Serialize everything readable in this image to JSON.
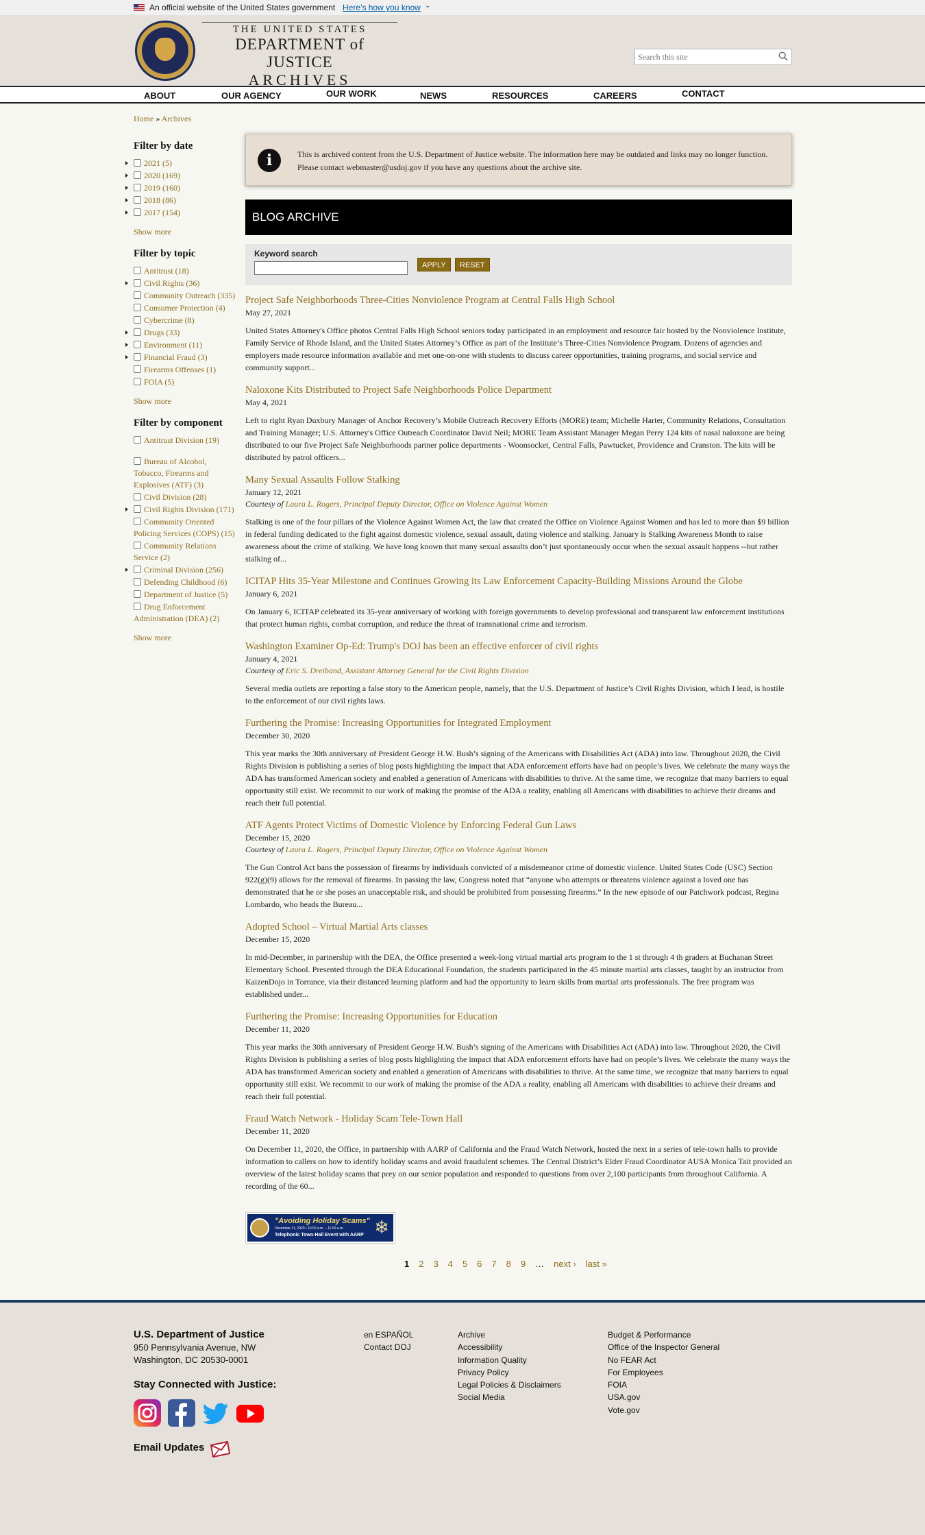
{
  "gov_banner": {
    "official_text": "An official website of the United States government",
    "how_link": "Here’s how you know"
  },
  "header": {
    "logo_line1": "THE UNITED STATES",
    "logo_line2": "DEPARTMENT of JUSTICE",
    "logo_line3": "ARCHIVES",
    "search_placeholder": "Search this site"
  },
  "nav": [
    "ABOUT",
    "OUR AGENCY",
    "OUR WORK",
    "NEWS",
    "RESOURCES",
    "CAREERS",
    "CONTACT"
  ],
  "breadcrumb": {
    "home": "Home",
    "sep": "»",
    "current": "Archives"
  },
  "sidebar": {
    "date_heading": "Filter by date",
    "dates": [
      {
        "label": "2021 (5)",
        "expandable": true
      },
      {
        "label": "2020 (169)",
        "expandable": true
      },
      {
        "label": "2019 (160)",
        "expandable": true
      },
      {
        "label": "2018 (86)",
        "expandable": true
      },
      {
        "label": "2017 (154)",
        "expandable": true
      }
    ],
    "topic_heading": "Filter by topic",
    "topics": [
      {
        "label": "Antitrust (18)",
        "expandable": false
      },
      {
        "label": "Civil Rights (36)",
        "expandable": true
      },
      {
        "label": "Community Outreach (335)",
        "expandable": false
      },
      {
        "label": "Consumer Protection (4)",
        "expandable": false
      },
      {
        "label": "Cybercrime (8)",
        "expandable": false
      },
      {
        "label": "Drugs (33)",
        "expandable": true
      },
      {
        "label": "Environment (11)",
        "expandable": true
      },
      {
        "label": "Financial Fraud (3)",
        "expandable": true
      },
      {
        "label": "Firearms Offenses (1)",
        "expandable": false
      },
      {
        "label": "FOIA (5)",
        "expandable": false
      }
    ],
    "component_heading": "Filter by component",
    "components": [
      {
        "label": "Antitrust Division (19)",
        "expandable": false
      },
      {
        "label": "Bureau of Alcohol, Tobacco, Firearms and Explosives (ATF) (3)",
        "expandable": false
      },
      {
        "label": "Civil Division (28)",
        "expandable": false
      },
      {
        "label": "Civil Rights Division (171)",
        "expandable": true
      },
      {
        "label": "Community Oriented Policing Services (COPS) (15)",
        "expandable": false
      },
      {
        "label": "Community Relations Service (2)",
        "expandable": false
      },
      {
        "label": "Criminal Division (256)",
        "expandable": true
      },
      {
        "label": "Defending Childhood (6)",
        "expandable": false
      },
      {
        "label": "Department of Justice (5)",
        "expandable": false
      },
      {
        "label": "Drug Enforcement Administration (DEA) (2)",
        "expandable": false
      }
    ],
    "show_more": "Show more"
  },
  "notice": {
    "text": "This is archived content from the U.S. Department of Justice website. The information here may be outdated and links may no longer function. Please contact webmaster@usdoj.gov if you have any questions about the archive site."
  },
  "blog": {
    "title": "BLOG ARCHIVE",
    "keyword_label": "Keyword search",
    "apply": "APPLY",
    "reset": "RESET"
  },
  "posts": [
    {
      "title": "Project Safe Neighborhoods Three-Cities Nonviolence Program at Central Falls High School",
      "date": "May 27, 2021",
      "body": "United States Attorney's Office photos Central Falls High School seniors today participated in an employment and resource fair hosted by the Nonviolence Institute, Family Service of Rhode Island, and the United States Attorney’s Office as part of the Institute’s Three-Cities Nonviolence Program. Dozens of agencies and employers made resource information available and met one-on-one with students to discuss career opportunities, training programs, and social service and community support..."
    },
    {
      "title": "Naloxone Kits Distributed to Project Safe Neighborhoods Police Department",
      "date": "May 4, 2021",
      "body": "Left to right Ryan Duxbury Manager of Anchor Recovery’s Mobile Outreach Recovery Efforts (MORE) team; Michelle Harter, Community Relations, Consultation and Training Manager; U.S. Attorney's Office Outreach Coordinator David Neil; MORE Team Assistant Manager Megan Perry 124 kits of nasal naloxone are being distributed to our five Project Safe Neighborhoods partner police departments - Woonsocket, Central Falls, Pawtucket, Providence and Cranston. The kits will be distributed by patrol officers..."
    },
    {
      "title": "Many Sexual Assaults Follow Stalking",
      "date": "January 12, 2021",
      "by_prefix": "Courtesy of",
      "author": "Laura L. Rogers, Principal Deputy Director, Office on Violence Against Women",
      "body": "Stalking is one of the four pillars of the Violence Against Women Act, the law that created the Office on Violence Against Women and has led to more than $9 billion in federal funding dedicated to the fight against domestic violence, sexual assault, dating violence and stalking. January is Stalking Awareness Month to raise awareness about the crime of stalking. We have long known that many sexual assaults don’t just spontaneously occur when the sexual assault happens --but rather stalking of..."
    },
    {
      "title": "ICITAP Hits 35-Year Milestone and Continues Growing its Law Enforcement Capacity-Building Missions Around the Globe",
      "date": "January 6, 2021",
      "body": "On January 6, ICITAP celebrated its 35-year anniversary of working with foreign governments to develop professional and transparent law enforcement institutions that protect human rights, combat corruption, and reduce the threat of transnational crime and terrorism."
    },
    {
      "title": "Washington Examiner Op-Ed: Trump's DOJ has been an effective enforcer of civil rights",
      "date": "January 4, 2021",
      "by_prefix": "Courtesy of",
      "author": "Eric S. Dreiband, Assistant Attorney General for the Civil Rights Division",
      "body": "Several media outlets are reporting a false story to the American people, namely, that the U.S. Department of Justice’s Civil Rights Division, which I lead, is hostile to the enforcement of our civil rights laws."
    },
    {
      "title": "Furthering the Promise: Increasing Opportunities for Integrated Employment",
      "date": "December 30, 2020",
      "body": "This year marks the 30th anniversary of President George H.W. Bush’s signing of the Americans with Disabilities Act (ADA) into law. Throughout 2020, the Civil Rights Division is publishing a series of blog posts highlighting the impact that ADA enforcement efforts have had on people’s lives. We celebrate the many ways the ADA has transformed American society and enabled a generation of Americans with disabilities to thrive. At the same time, we recognize that many barriers to equal opportunity still exist. We recommit to our work of making the promise of the ADA a reality, enabling all Americans with disabilities to achieve their dreams and reach their full potential."
    },
    {
      "title": "ATF Agents Protect Victims of Domestic Violence by Enforcing Federal Gun Laws",
      "date": "December 15, 2020",
      "by_prefix": "Courtesy of",
      "author": "Laura L. Rogers, Principal Deputy Director, Office on Violence Against Women",
      "body": "The Gun Control Act bans the possession of firearms by individuals convicted of a misdemeanor crime of domestic violence. United States Code (USC) Section 922(g)(9) allows for the removal of firearms. In passing the law, Congress noted that “anyone who attempts or threatens violence against a loved one has demonstrated that he or she poses an unacceptable risk, and should be prohibited from possessing firearms.” In the new episode of our Patchwork podcast, Regina Lombardo, who heads the Bureau..."
    },
    {
      "title": "Adopted School – Virtual Martial Arts classes",
      "date": "December 15, 2020",
      "body": "In mid-December, in partnership with the DEA, the Office presented a week-long virtual martial arts program to the 1 st through 4 th graders at Buchanan Street Elementary School. Presented through the DEA Educational Foundation, the students participated in the 45 minute martial arts classes, taught by an instructor from KaizenDojo in Torrance, via their distanced learning platform and had the opportunity to learn skills from martial arts professionals. The free program was established under..."
    },
    {
      "title": "Furthering the Promise: Increasing Opportunities for Education",
      "date": "December 11, 2020",
      "body": "This year marks the 30th anniversary of President George H.W. Bush’s signing of the Americans with Disabilities Act (ADA) into law. Throughout 2020, the Civil Rights Division is publishing a series of blog posts highlighting the impact that ADA enforcement efforts have had on people’s lives. We celebrate the many ways the ADA has transformed American society and enabled a generation of Americans with disabilities to thrive. At the same time, we recognize that many barriers to equal opportunity still exist. We recommit to our work of making the promise of the ADA a reality, enabling all Americans with disabilities to achieve their dreams and reach their full potential."
    },
    {
      "title": "Fraud Watch Network - Holiday Scam Tele-Town Hall",
      "date": "December 11, 2020",
      "body": "On December 11, 2020, the Office, in partnership with AARP of California and the Fraud Watch Network, hosted the next in a series of tele-town halls to provide information to callers on how to identify holiday scams and avoid fraudulent schemes. The Central District’s Elder Fraud Coordinator AUSA Monica Tait provided an overview of the latest holiday scams that prey on our senior population and responded to questions from over 2,100 participants from throughout California. A recording of the 60..."
    }
  ],
  "promo": {
    "title": "\"Avoiding Holiday Scams\"",
    "date_line": "December 11, 2020 • 10:00 a.m. – 11:00 a.m.",
    "subtitle": "Telephonic Town-Hall Event with AARP"
  },
  "pager": {
    "pages": [
      "1",
      "2",
      "3",
      "4",
      "5",
      "6",
      "7",
      "8",
      "9"
    ],
    "current": "1",
    "ellipsis": "…",
    "next": "next ›",
    "last": "last »"
  },
  "footer": {
    "org": "U.S. Department of Justice",
    "address1": "950 Pennsylvania Avenue, NW",
    "address2": "Washington, DC 20530-0001",
    "stay_connected": "Stay Connected with Justice:",
    "email_updates": "Email Updates",
    "col1": [
      "en ESPAÑOL",
      "Contact DOJ"
    ],
    "col2": [
      "Archive",
      "Accessibility",
      "Information Quality",
      "Privacy Policy",
      "Legal Policies & Disclaimers",
      "Social Media"
    ],
    "col3": [
      "Budget & Performance",
      "Office of the Inspector General",
      "No FEAR Act",
      "For Employees",
      "FOIA",
      "USA.gov",
      "Vote.gov"
    ]
  },
  "colors": {
    "link_gold": "#8d6b1d",
    "button_gold": "#8a6a14",
    "footer_rule": "#1a3a5e",
    "header_bg": "#e6e0da",
    "notice_bg": "#e8ddd1"
  }
}
